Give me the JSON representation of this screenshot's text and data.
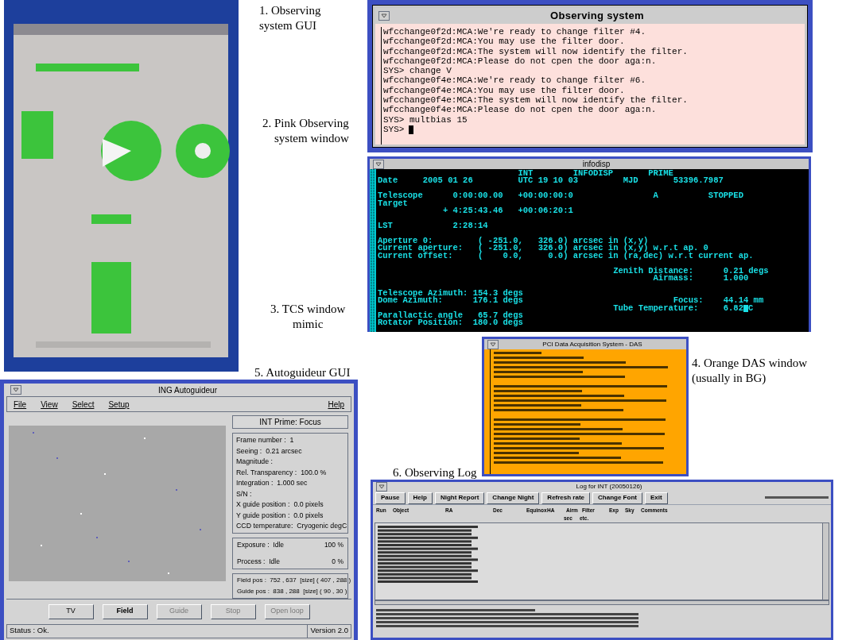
{
  "captions": [
    {
      "lines": [
        "1. Observing",
        "system GUI"
      ]
    },
    {
      "lines": [
        "2. Pink Observing",
        "system window"
      ]
    },
    {
      "lines": [
        "3. TCS  window",
        "mimic"
      ]
    },
    {
      "lines": [
        "5. Autoguideur GUI"
      ]
    },
    {
      "lines": [
        "4. Orange DAS window",
        "(usually in BG)"
      ]
    },
    {
      "lines": [
        "6. Observing Log"
      ]
    }
  ],
  "observing_system": {
    "title": "Observing system",
    "lines": [
      "wfcchange0f2d:MCA:We're ready to change filter #4.",
      "wfcchange0f2d:MCA:You may use the filter door.",
      "wfcchange0f2d:MCA:The system will now identify the filter.",
      "wfcchange0f2d:MCA:Please do not cpen the door aga:n.",
      "SYS> change V",
      "wfcchange0f4e:MCA:We're ready to change filter #6.",
      "wfcchange0f4e:MCA:You may use the filter door.",
      "wfcchange0f4e:MCA:The system will now identify the filter.",
      "wfcchange0f4e:MCA:Please do not cpen the door aga:n.",
      "SYS> multbias 15"
    ],
    "prompt": "SYS>"
  },
  "infodisp": {
    "title": "infodisp",
    "blocks": [
      [
        {
          "text": "                            INT        INFODISP       PRIME"
        },
        {
          "text": "Date     2005 01 26         UTC 19 10 03         MJD       53396.7987"
        }
      ],
      [
        {
          "text": "Telescope      0:00:00.00   +00:00:00:0                A          STOPPED"
        },
        {
          "text": "Target"
        },
        {
          "text": "             + 4:25:43.46   +00:06:20:1"
        }
      ],
      [
        {
          "text": "LST            2:28:14"
        }
      ],
      [
        {
          "text": "Aperture 0:         ( -251.0,   326.0) arcsec in (x,y)"
        },
        {
          "text": "Current aperture:   ( -251.0,   326.0) arcsec in (x,y) w.r.t ap. 0"
        },
        {
          "text": "Current offset:     (    0.0,     0.0) arcsec in (ra,dec) w.r.t current ap."
        }
      ],
      [
        {
          "text": "                                               Zenith Distance:      0.21 degs"
        },
        {
          "text": "                                                       Airmass:      1.000"
        }
      ],
      [
        {
          "text": "Telescope Azimuth: 154.3 degs"
        },
        {
          "text": "Dome Azimuth:      176.1 degs                              Focus:    44.14 mm"
        },
        {
          "text": "                                               Tube Temperature:     6.82",
          "cursor": true,
          "after": "C"
        },
        {
          "text": "Parallactic angle   65.7 degs"
        },
        {
          "text": "Rotator Position:  180.0 degs"
        }
      ]
    ]
  },
  "das": {
    "title": "PCI Data Acquisition System - DAS"
  },
  "autoguider": {
    "title": "ING Autoguideur",
    "menus": [
      "File",
      "View",
      "Select",
      "Setup"
    ],
    "help_menu": "Help",
    "mode": "INT Prime: Focus",
    "info": [
      "Frame number :  1",
      "Seeing :  0.21 arcsec",
      "Magnitude :",
      "Rel. Transparency :  100.0 %",
      "Integration :  1.000 sec",
      "S/N :",
      "X guide position :  0.0 pixels",
      "Y guide position :  0.0 pixels",
      "CCD temperature:  Cryogenic degC"
    ],
    "progress": [
      {
        "label": "Exposure :  Idle",
        "value": "100 %"
      },
      {
        "label": "Process :  Idle",
        "value": "0 %"
      }
    ],
    "positions": [
      "Field pos :  752 , 637  [size] ( 407 , 288 )",
      "Guide pos :  838 , 288  [size] ( 90 , 30 )"
    ],
    "buttons": [
      {
        "label": "TV",
        "disabled": false,
        "selected": false
      },
      {
        "label": "Field",
        "disabled": false,
        "selected": true
      },
      {
        "label": "Guide",
        "disabled": true,
        "selected": false
      },
      {
        "label": "Stop",
        "disabled": true,
        "selected": false
      },
      {
        "label": "Open loop",
        "disabled": true,
        "selected": false
      }
    ],
    "status": "Status : Ok.",
    "version": "Version 2.0"
  },
  "observing_log": {
    "title": "Log for INT (20050126)",
    "buttons": [
      "Pause",
      "Help",
      "Night Report",
      "Change Night",
      "Refresh rate",
      "Change Font",
      "Exit"
    ],
    "columns": [
      "Run",
      "Object",
      "RA",
      "Dec",
      "Equinox",
      "HA",
      "Airm",
      "Filter",
      "Exp",
      "Sky",
      "Comments"
    ],
    "subheaders": [
      "sec",
      "etc."
    ]
  }
}
